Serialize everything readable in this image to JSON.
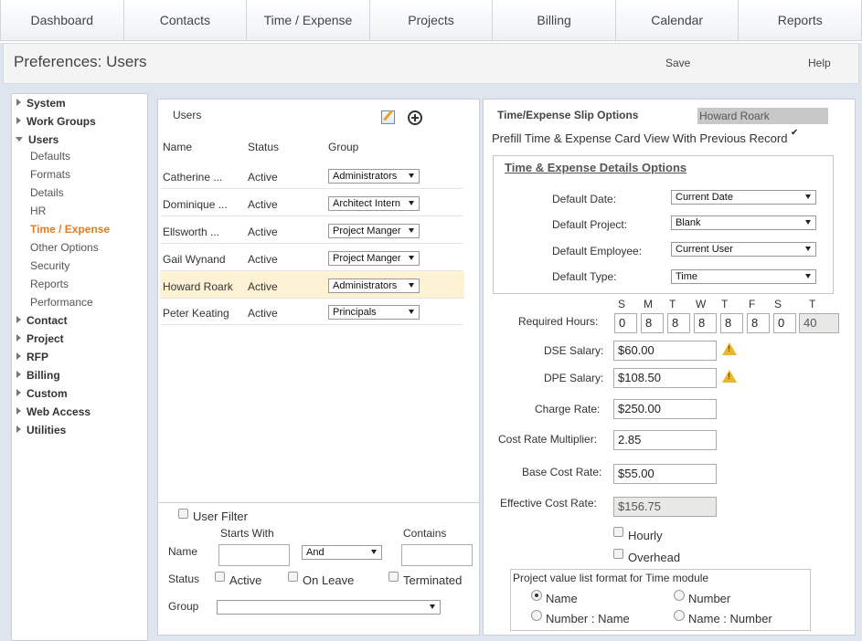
{
  "nav": {
    "tabs": [
      "Dashboard",
      "Contacts",
      "Time / Expense",
      "Projects",
      "Billing",
      "Calendar",
      "Reports"
    ]
  },
  "header": {
    "title": "Preferences: Users",
    "save_label": "Save",
    "help_label": "Help"
  },
  "sidebar": {
    "items": [
      {
        "label": "System"
      },
      {
        "label": "Work Groups"
      },
      {
        "label": "Users"
      },
      {
        "label": "Defaults"
      },
      {
        "label": "Formats"
      },
      {
        "label": "Details"
      },
      {
        "label": "HR"
      },
      {
        "label": "Time / Expense"
      },
      {
        "label": "Other Options"
      },
      {
        "label": "Security"
      },
      {
        "label": "Reports"
      },
      {
        "label": "Performance"
      },
      {
        "label": "Contact"
      },
      {
        "label": "Project"
      },
      {
        "label": "RFP"
      },
      {
        "label": "Billing"
      },
      {
        "label": "Custom"
      },
      {
        "label": "Web Access"
      },
      {
        "label": "Utilities"
      }
    ],
    "active": "Time / Expense"
  },
  "users": {
    "title": "Users",
    "columns": [
      "Name",
      "Status",
      "Group"
    ],
    "rows": [
      {
        "name": "Catherine ...",
        "status": "Active",
        "group": "Administrators"
      },
      {
        "name": "Dominique ...",
        "status": "Active",
        "group": "Architect Intern"
      },
      {
        "name": "Ellsworth ...",
        "status": "Active",
        "group": "Project Manger"
      },
      {
        "name": "Gail Wynand",
        "status": "Active",
        "group": "Project Manger"
      },
      {
        "name": "Howard Roark",
        "status": "Active",
        "group": "Administrators"
      },
      {
        "name": "Peter Keating",
        "status": "Active",
        "group": "Principals"
      }
    ],
    "selected": "Howard Roark",
    "filter": {
      "title": "User Filter",
      "starts_with_label": "Starts With",
      "contains_label": "Contains",
      "name_label": "Name",
      "and_value": "And",
      "status_label": "Status",
      "active_label": "Active",
      "on_leave_label": "On Leave",
      "terminated_label": "Terminated",
      "group_label": "Group"
    }
  },
  "options": {
    "title": "Time/Expense Slip Options",
    "user": "Howard Roark",
    "prefill_label": "Prefill Time & Expense Card View With Previous Record",
    "prefill_checked": true,
    "details": {
      "title": "Time & Expense Details Options",
      "fields": [
        {
          "label": "Default Date:",
          "value": "Current Date"
        },
        {
          "label": "Default Project:",
          "value": "Blank"
        },
        {
          "label": "Default Employee:",
          "value": "Current User"
        },
        {
          "label": "Default Type:",
          "value": "Time"
        }
      ]
    },
    "days": [
      "S",
      "M",
      "T",
      "W",
      "T",
      "F",
      "S",
      "T"
    ],
    "required_hours_label": "Required Hours:",
    "hours": [
      "0",
      "8",
      "8",
      "8",
      "8",
      "8",
      "0",
      "40"
    ],
    "dse_label": "DSE Salary:",
    "dse_value": "$60.00",
    "dpe_label": "DPE Salary:",
    "dpe_value": "$108.50",
    "charge_label": "Charge Rate:",
    "charge_value": "$250.00",
    "mult_label": "Cost Rate Multiplier:",
    "mult_value": "2.85",
    "base_label": "Base Cost Rate:",
    "base_value": "$55.00",
    "eff_label": "Effective Cost Rate:",
    "eff_value": "$156.75",
    "hourly_label": "Hourly",
    "overhead_label": "Overhead",
    "pvl": {
      "title": "Project value list format for Time module",
      "options": [
        "Name",
        "Number",
        "Number : Name",
        "Name : Number"
      ],
      "selected": "Name"
    }
  },
  "colors": {
    "accent": "#e87a1f",
    "highlight_row": "#fdf3d4",
    "warning": "#e9b72a"
  }
}
